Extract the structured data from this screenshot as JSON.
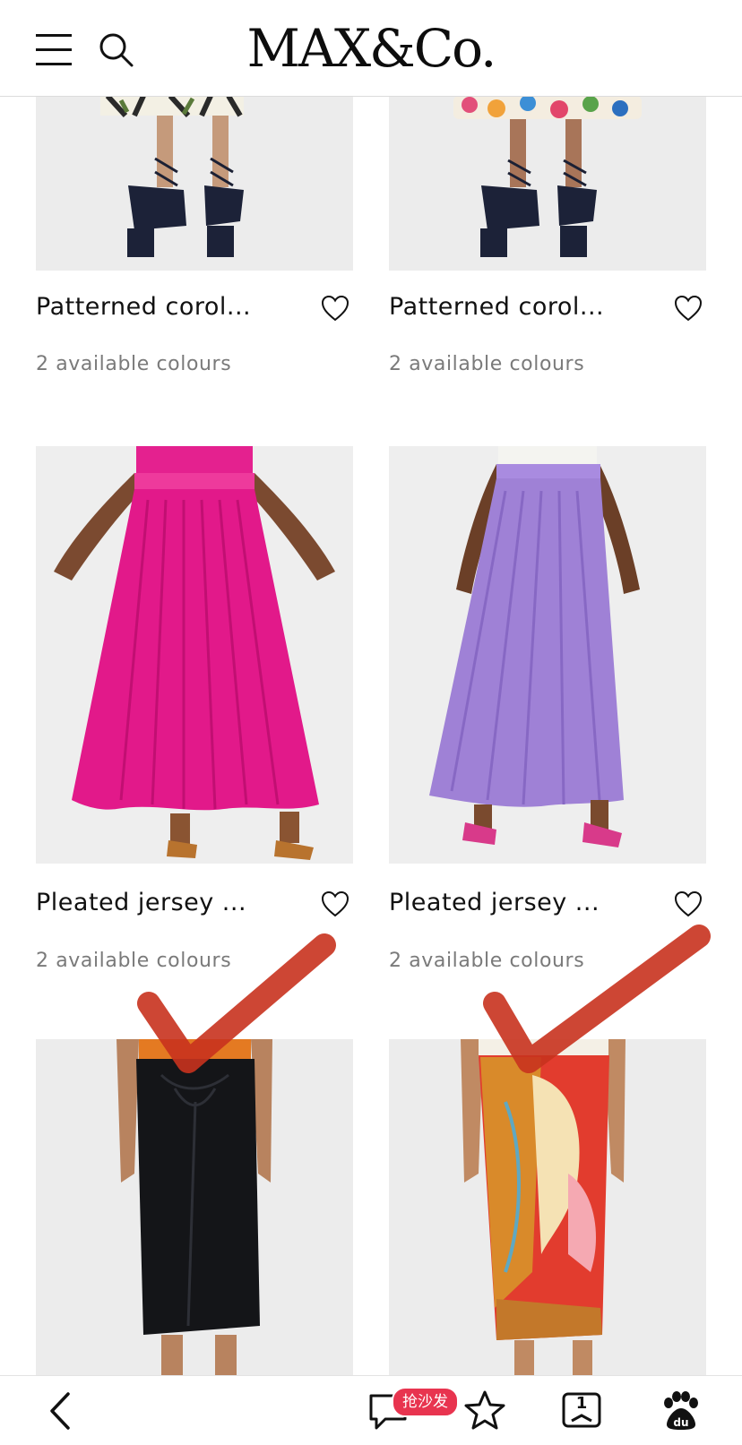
{
  "header": {
    "brand": "MAX&Co.",
    "icons": [
      "menu-icon",
      "search-icon"
    ]
  },
  "products": [
    {
      "name": "Patterned corol...",
      "colours": "2 available colours",
      "image": "skirt-patterned-floral-black-white",
      "favorite": false
    },
    {
      "name": "Patterned corol...",
      "colours": "2 available colours",
      "image": "skirt-patterned-floral-multicolour",
      "favorite": false
    },
    {
      "name": "Pleated jersey ...",
      "colours": "2 available colours",
      "image": "pleated-skirt-fuchsia",
      "favorite": false
    },
    {
      "name": "Pleated jersey ...",
      "colours": "2 available colours",
      "image": "pleated-skirt-lilac",
      "favorite": false
    },
    {
      "name": "",
      "colours": "",
      "image": "draped-skirt-black",
      "favorite": false
    },
    {
      "name": "",
      "colours": "",
      "image": "draped-skirt-printed",
      "favorite": false
    }
  ],
  "browser_toolbar": {
    "icons": [
      "back-icon",
      "comments-icon",
      "star-icon",
      "tabs-icon",
      "baidu-icon"
    ],
    "comment_badge": "抢沙发",
    "tab_count": "1"
  },
  "colors": {
    "text": "#111111",
    "secondary_text": "#7a7a7a",
    "badge": "#e8344f",
    "annotation_mark": "#c8321e",
    "image_background": "#ececec"
  }
}
